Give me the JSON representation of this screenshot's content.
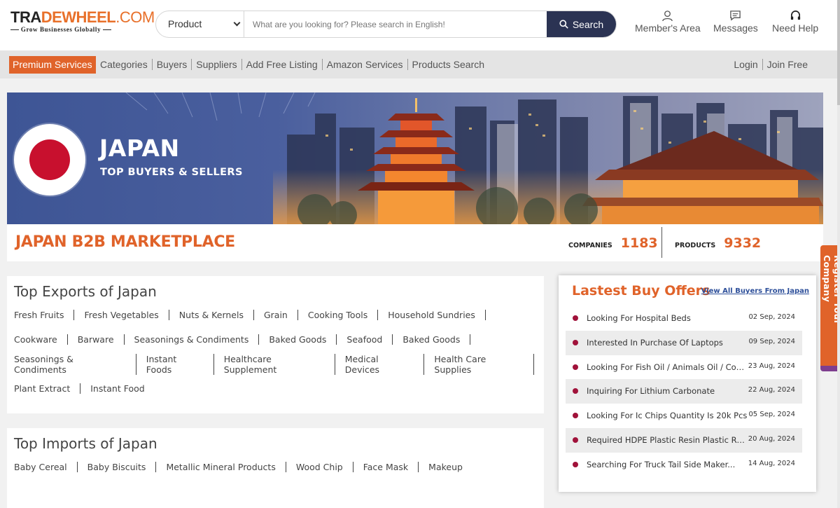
{
  "logo": {
    "part1": "TRA",
    "part2": "DEWHEEL",
    "part3": ".COM",
    "tagline": "Grow Businesses Globally"
  },
  "search": {
    "category": "Product",
    "placeholder": "What are you looking for? Please search in English!",
    "button": "Search"
  },
  "header_links": {
    "members": "Member's Area",
    "messages": "Messages",
    "help": "Need Help"
  },
  "nav": {
    "premium": "Premium Services",
    "items": [
      "Categories",
      "Buyers",
      "Suppliers",
      "Add Free Listing",
      "Amazon Services",
      "Products Search"
    ],
    "login": "Login",
    "join": "Join Free"
  },
  "banner": {
    "title": "JAPAN",
    "subtitle": "TOP BUYERS & SELLERS"
  },
  "marketplace": {
    "title": "JAPAN B2B MARKETPLACE",
    "companies_label": "COMPANIES",
    "companies_value": "1183",
    "products_label": "PRODUCTS",
    "products_value": "9332"
  },
  "exports": {
    "title": "Top Exports of Japan",
    "rows": [
      [
        "Fresh Fruits",
        "Fresh Vegetables",
        "Nuts & Kernels",
        "Grain",
        "Cooking Tools",
        "Household Sundries"
      ],
      [
        "Cookware",
        "Barware",
        "Seasonings & Condiments",
        "Baked Goods",
        "Seafood",
        "Baked Goods"
      ],
      [
        "Seasonings & Condiments",
        "Instant Foods",
        "Healthcare Supplement",
        "Medical Devices",
        "Health Care Supplies"
      ],
      [
        "Plant Extract",
        "Instant Food"
      ]
    ]
  },
  "imports": {
    "title": "Top Imports of Japan",
    "rows": [
      [
        "Baby Cereal",
        "Baby Biscuits",
        "Metallic Mineral Products",
        "Wood Chip",
        "Face Mask",
        "Makeup"
      ]
    ]
  },
  "offers": {
    "title": "Lastest Buy Offers",
    "view_all": "View All Buyers From Japan",
    "items": [
      {
        "text": "Looking For Hospital Beds",
        "date": "02 Sep, 2024"
      },
      {
        "text": "Interested In Purchase Of Laptops",
        "date": "09 Sep, 2024"
      },
      {
        "text": "Looking For Fish Oil / Animals Oil / Cod...",
        "date": "23 Aug, 2024"
      },
      {
        "text": "Inquiring For Lithium Carbonate",
        "date": "22 Aug, 2024"
      },
      {
        "text": "Looking For Ic Chips Quantity Is 20k Pcs",
        "date": "05 Sep, 2024"
      },
      {
        "text": "Required HDPE Plastic Resin Plastic Raw...",
        "date": "20 Aug, 2024"
      },
      {
        "text": "Searching For Truck Tail Side Maker...",
        "date": "14 Aug, 2024"
      }
    ]
  },
  "register_tab": "Register Your Company",
  "icons": {
    "search": "search-icon",
    "member": "user-icon",
    "messages": "message-icon",
    "help": "headset-icon",
    "chevron": "chevron-down-icon"
  },
  "colors": {
    "accent": "#e0632a",
    "dark_button": "#2b3353",
    "link": "#2d4f9a",
    "bullet": "#a0123a",
    "flag_red": "#c8102e"
  }
}
